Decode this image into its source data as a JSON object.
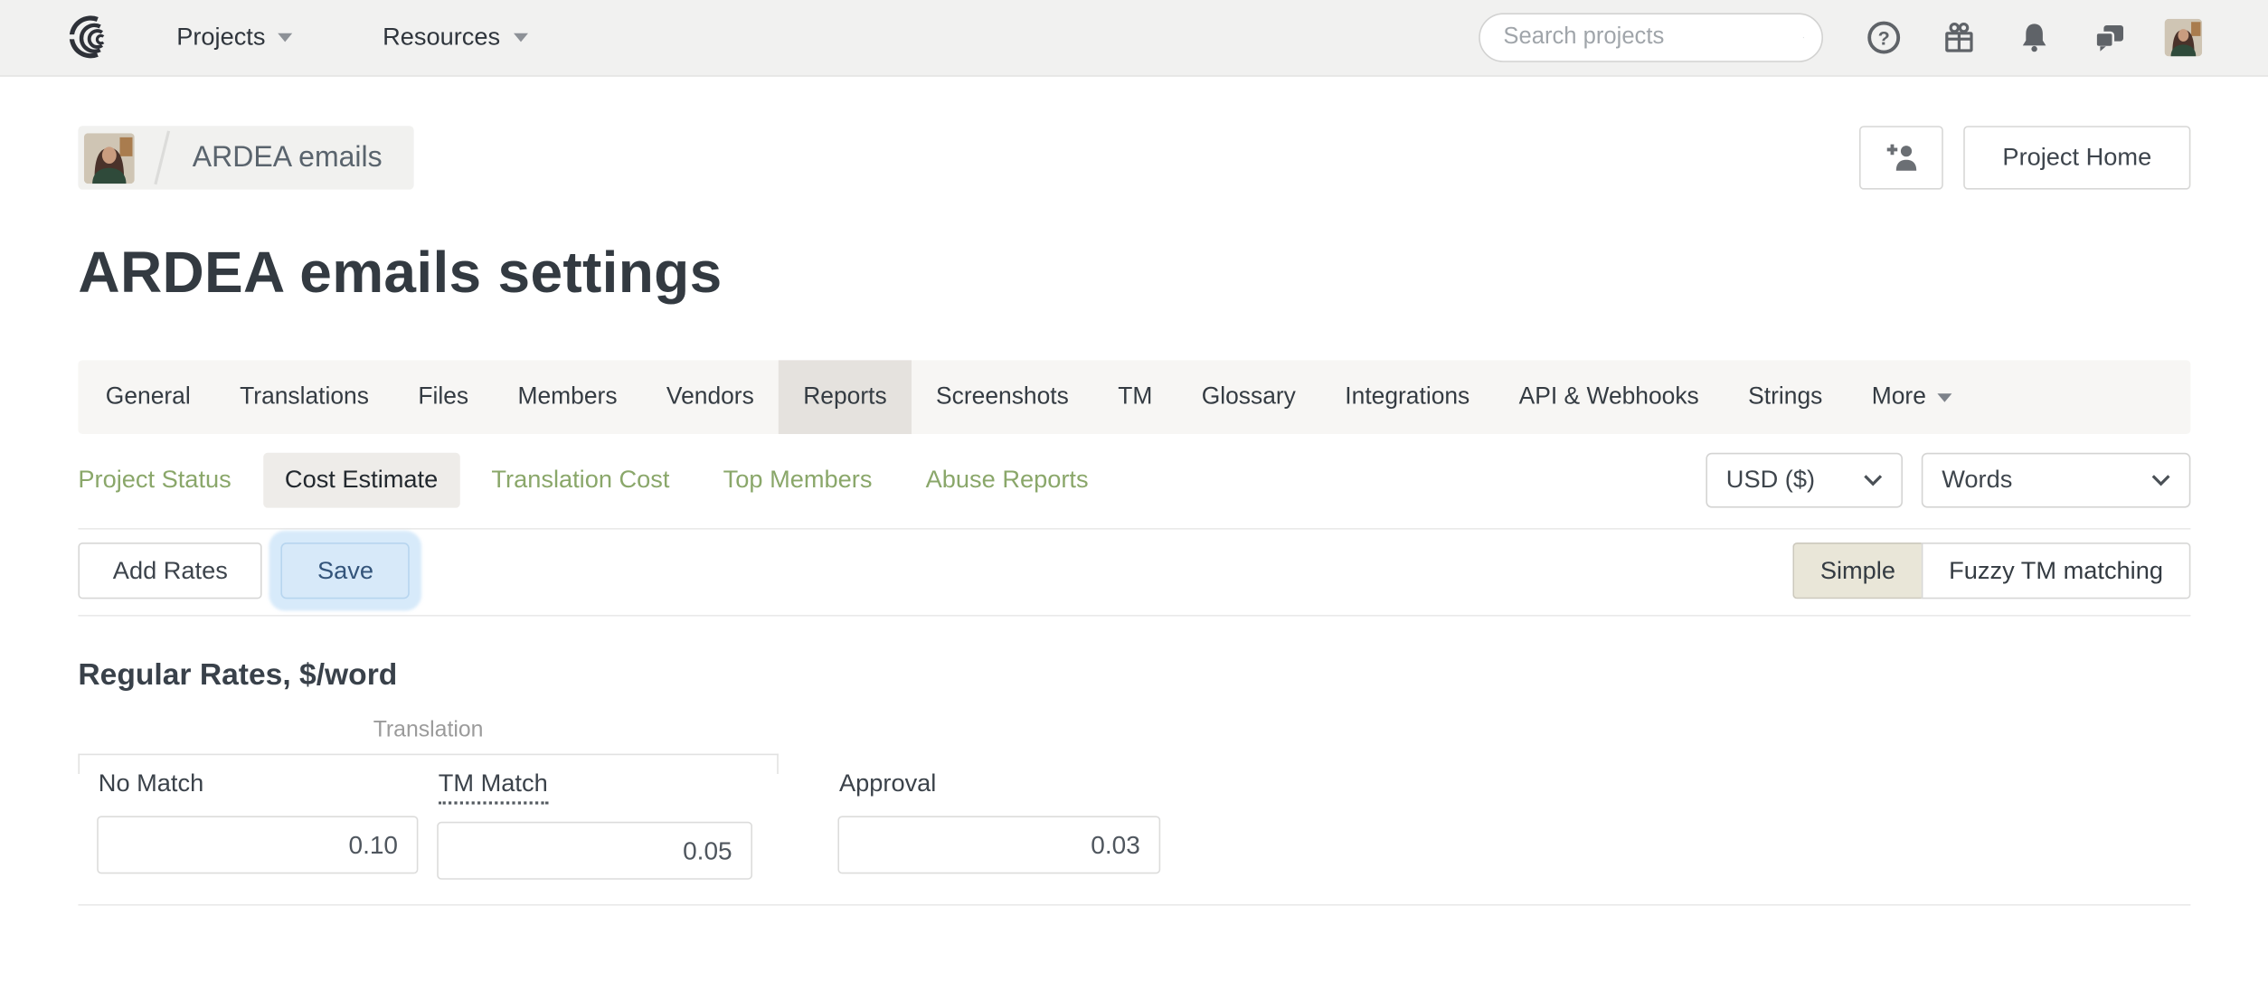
{
  "header": {
    "nav": [
      {
        "label": "Projects"
      },
      {
        "label": "Resources"
      }
    ],
    "search_placeholder": "Search projects",
    "icons": [
      "help-icon",
      "gift-icon",
      "bell-icon",
      "messages-icon",
      "user-avatar"
    ]
  },
  "breadcrumb": {
    "project_name": "ARDEA emails"
  },
  "actions": {
    "invite_icon": "person-add-icon",
    "project_home_label": "Project Home"
  },
  "page_title": "ARDEA emails settings",
  "tabs": {
    "items": [
      "General",
      "Translations",
      "Files",
      "Members",
      "Vendors",
      "Reports",
      "Screenshots",
      "TM",
      "Glossary",
      "Integrations",
      "API & Webhooks",
      "Strings",
      "More"
    ],
    "active": "Reports"
  },
  "subtabs": {
    "items": [
      "Project Status",
      "Cost Estimate",
      "Translation Cost",
      "Top Members",
      "Abuse Reports"
    ],
    "active": "Cost Estimate"
  },
  "selects": {
    "currency": "USD ($)",
    "unit": "Words"
  },
  "toolbar": {
    "add_rates_label": "Add Rates",
    "save_label": "Save"
  },
  "mode_toggle": {
    "options": [
      "Simple",
      "Fuzzy TM matching"
    ],
    "active": "Simple"
  },
  "rates": {
    "heading": "Regular Rates, $/word",
    "group_label": "Translation",
    "fields": [
      {
        "label": "No Match",
        "value": "0.10",
        "group": "Translation"
      },
      {
        "label": "TM Match",
        "value": "0.05",
        "group": "Translation",
        "has_tooltip": true
      },
      {
        "label": "Approval",
        "value": "0.03"
      }
    ]
  },
  "colors": {
    "accent_green_link": "#8aa76a",
    "active_tab_bg": "#e5e2de",
    "active_subtab_bg": "#eeece9",
    "simple_active_bg": "#e9e6d8",
    "save_focus_bg": "#d7e9f9",
    "header_bg": "#f1f1f0"
  }
}
